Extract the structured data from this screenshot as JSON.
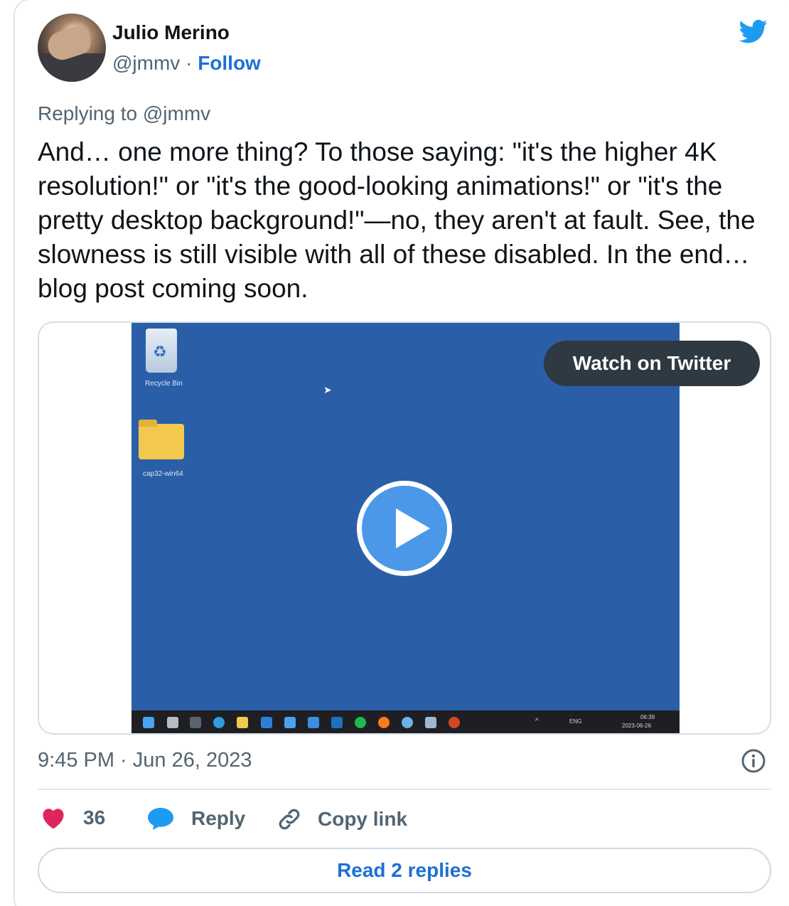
{
  "author": {
    "name": "Julio Merino",
    "handle": "@jmmv",
    "separator": "·",
    "follow_label": "Follow"
  },
  "tweet": {
    "replying_to": "Replying to @jmmv",
    "text": "And… one more thing? To those saying: \"it's the higher 4K resolution!\" or \"it's the good-looking animations!\" or \"it's the pretty desktop background!\"—no, they aren't at fault. See, the slowness is still visible with all of these disabled. In the end… blog post coming soon.",
    "timestamp": "9:45 PM · Jun 26, 2023"
  },
  "media": {
    "watch_label": "Watch on Twitter",
    "desktop_icons": [
      "Recycle Bin",
      "cap32-win64"
    ],
    "tray_lang": "ENG",
    "tray_time": "06:39",
    "tray_date": "2023-06-26"
  },
  "actions": {
    "likes_count": "36",
    "reply_label": "Reply",
    "copy_label": "Copy link"
  },
  "read_replies_label": "Read 2 replies",
  "colors": {
    "accent": "#1d70d6",
    "like": "#e0245e",
    "reply_bubble": "#1d9bf0",
    "twitter_bird": "#1d9bf0"
  },
  "icons": [
    "twitter-bird-icon",
    "play-icon",
    "info-icon",
    "heart-icon",
    "reply-bubble-icon",
    "link-icon"
  ]
}
